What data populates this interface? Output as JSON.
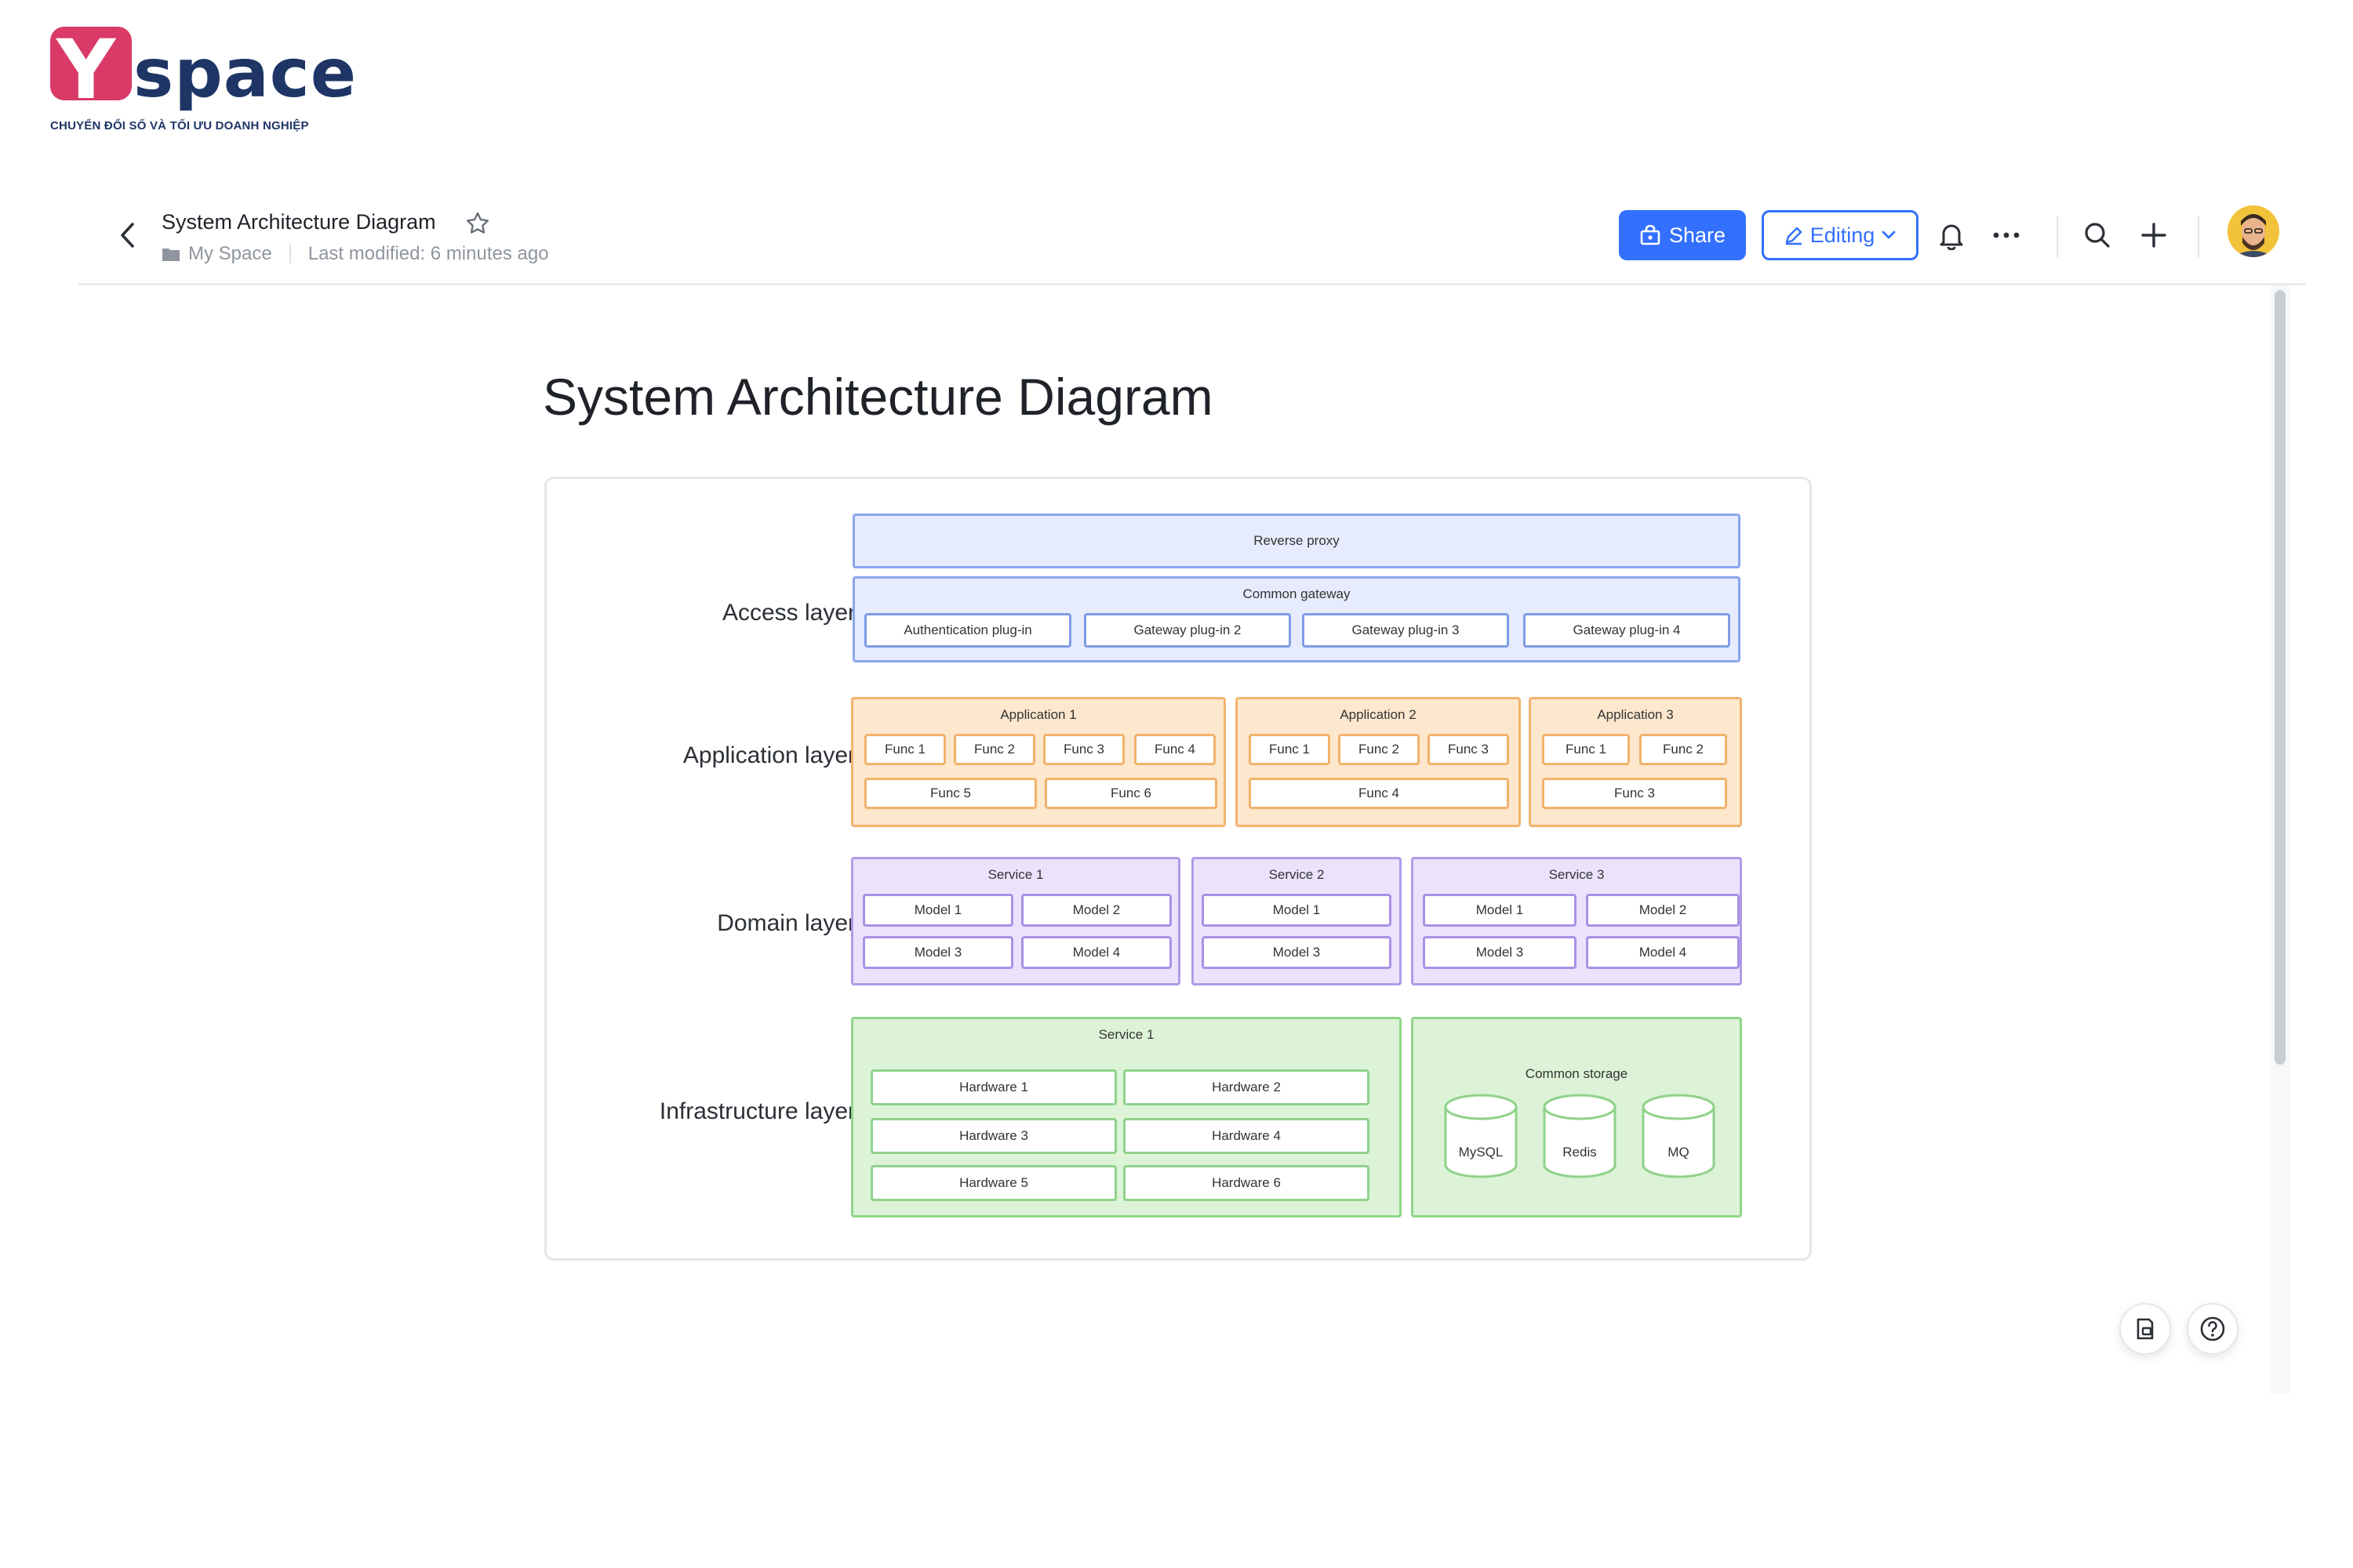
{
  "brand": {
    "logo_letter": "Y",
    "logo_word": "space",
    "tagline": "CHUYỂN ĐỔI SỐ VÀ TỐI ƯU DOANH NGHIỆP",
    "colors": {
      "pink": "#d93a68",
      "navy": "#1e3566"
    }
  },
  "header": {
    "doc_title": "System Architecture Diagram",
    "breadcrumb_space": "My Space",
    "last_modified": "Last modified: 6 minutes ago",
    "share_label": "Share",
    "editing_label": "Editing",
    "icons": [
      "back-icon",
      "star-icon",
      "folder-icon",
      "share-lock-icon",
      "pencil-icon",
      "chevron-down-icon",
      "bell-icon",
      "more-icon",
      "search-icon",
      "plus-icon",
      "avatar"
    ],
    "accent": "#3370ff"
  },
  "page": {
    "title": "System Architecture Diagram"
  },
  "diagram": {
    "layers": {
      "access": "Access layer",
      "application": "Application layer",
      "domain": "Domain layer",
      "infrastructure": "Infrastructure layer"
    },
    "access": {
      "reverse_proxy": "Reverse proxy",
      "common_gateway": "Common gateway",
      "plugins": [
        "Authentication plug-in",
        "Gateway plug-in 2",
        "Gateway plug-in 3",
        "Gateway plug-in 4"
      ]
    },
    "application": {
      "apps": [
        {
          "title": "Application 1",
          "funcs": [
            "Func 1",
            "Func 2",
            "Func 3",
            "Func 4",
            "Func 5",
            "Func 6"
          ]
        },
        {
          "title": "Application 2",
          "funcs": [
            "Func 1",
            "Func 2",
            "Func 3",
            "Func 4"
          ]
        },
        {
          "title": "Application 3",
          "funcs": [
            "Func 1",
            "Func 2",
            "Func 3"
          ]
        }
      ]
    },
    "domain": {
      "services": [
        {
          "title": "Service 1",
          "models": [
            "Model 1",
            "Model 2",
            "Model 3",
            "Model 4"
          ]
        },
        {
          "title": "Service 2",
          "models": [
            "Model 1",
            "Model 3"
          ]
        },
        {
          "title": "Service 3",
          "models": [
            "Model 1",
            "Model 2",
            "Model 3",
            "Model 4"
          ]
        }
      ]
    },
    "infrastructure": {
      "service_title": "Service 1",
      "hardware": [
        "Hardware 1",
        "Hardware 2",
        "Hardware 3",
        "Hardware 4",
        "Hardware 5",
        "Hardware 6"
      ],
      "storage_title": "Common storage",
      "storage": [
        "MySQL",
        "Redis",
        "MQ"
      ]
    }
  },
  "floating": {
    "icons": [
      "outline-icon",
      "help-icon"
    ]
  }
}
